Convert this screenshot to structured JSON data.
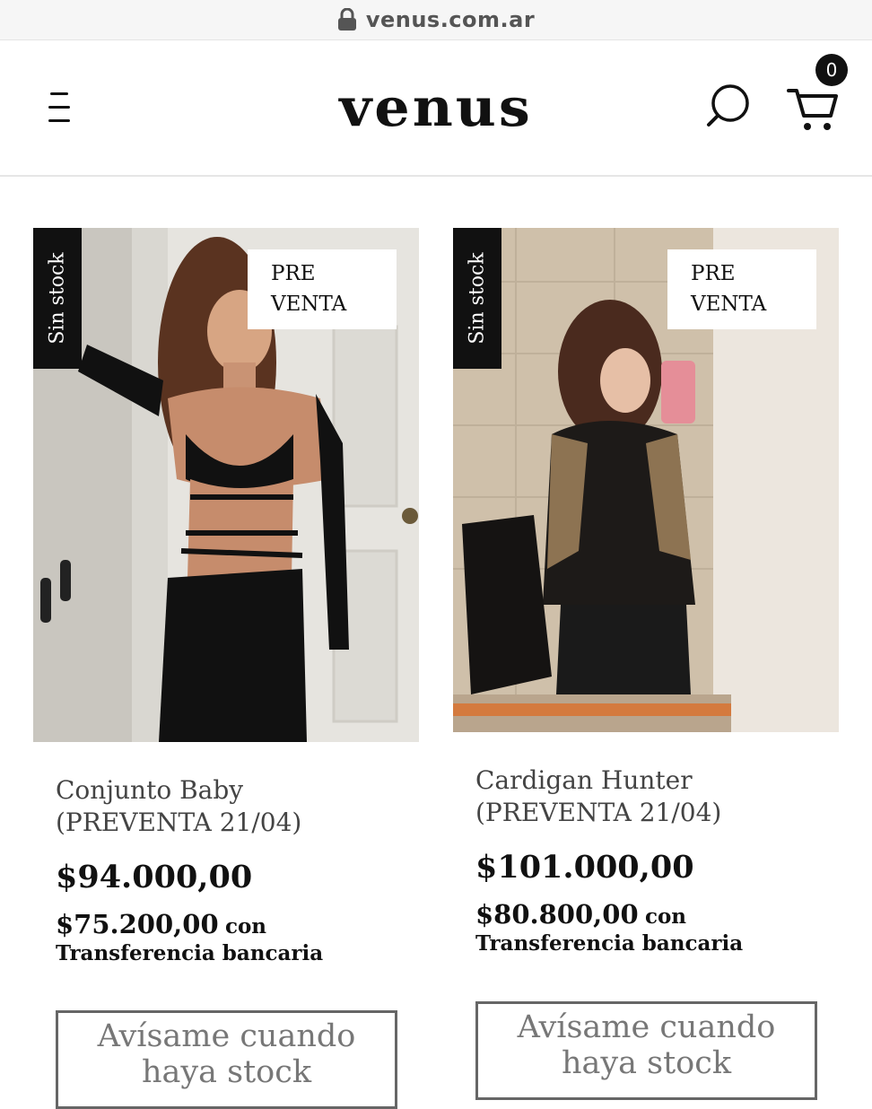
{
  "browser": {
    "url": "venus.com.ar"
  },
  "header": {
    "logo": "venus",
    "cart_count": "0"
  },
  "products": [
    {
      "stock_label": "Sin stock",
      "badge_line1": "PRE",
      "badge_line2": "VENTA",
      "name": "Conjunto Baby (PREVENTA 21/04)",
      "price": "$94.000,00",
      "transfer_price": "$75.200,00",
      "transfer_con": "con",
      "transfer_method": "Transferencia bancaria",
      "notify_label": "Avísame cuando haya stock"
    },
    {
      "stock_label": "Sin stock",
      "badge_line1": "PRE",
      "badge_line2": "VENTA",
      "name": "Cardigan Hunter (PREVENTA 21/04)",
      "price": "$101.000,00",
      "transfer_price": "$80.800,00",
      "transfer_con": "con",
      "transfer_method": "Transferencia bancaria",
      "notify_label": "Avísame cuando haya stock"
    }
  ]
}
